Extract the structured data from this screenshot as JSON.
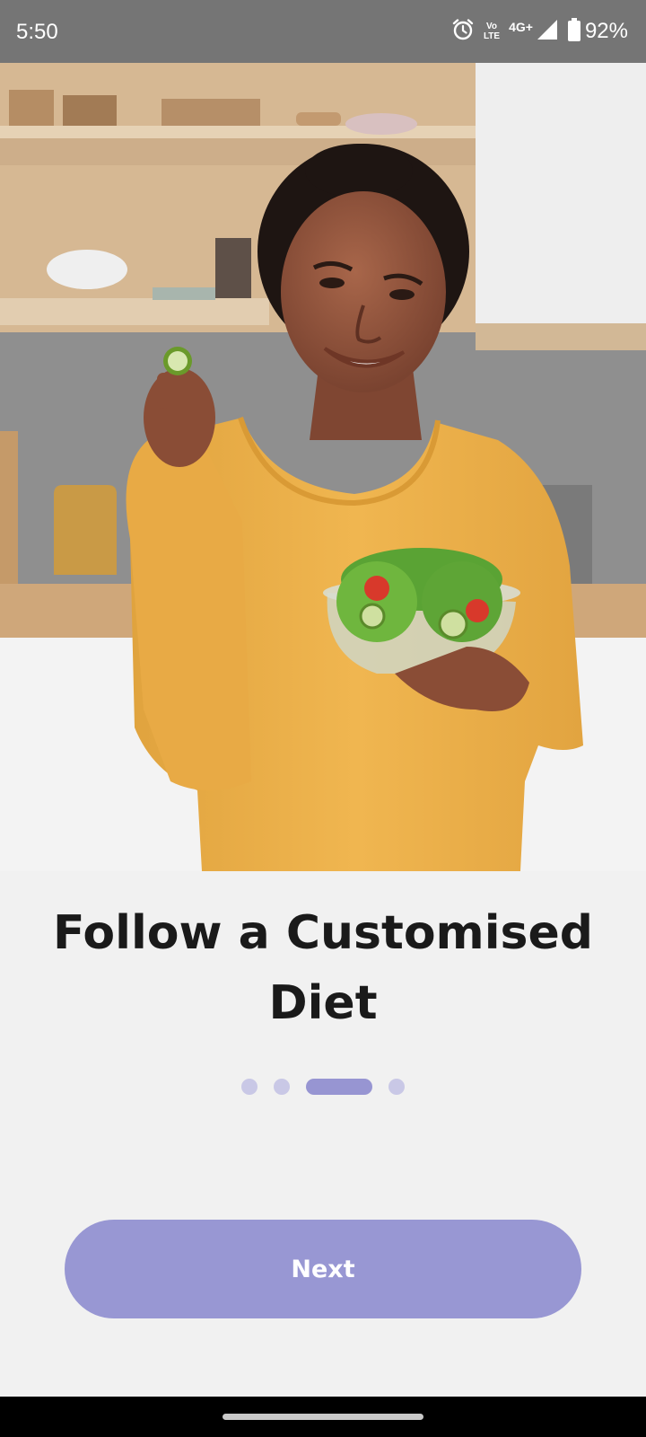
{
  "status_bar": {
    "time": "5:50",
    "volte_line1": "Vo",
    "volte_line2": "LTE",
    "network": "4G+",
    "battery": "92%",
    "icons": [
      "alarm-icon",
      "volte-icon",
      "signal-icon",
      "battery-icon"
    ]
  },
  "hero": {
    "icon": "woman-holding-salad-photo"
  },
  "onboarding": {
    "title": "Follow a Customised Diet",
    "page_count": 4,
    "current_page": 3
  },
  "next_button": {
    "label": "Next"
  },
  "colors": {
    "accent": "#9897d3",
    "dot_inactive": "#c9c8e6",
    "background": "#f1f1f1",
    "status_bar": "#757575"
  }
}
